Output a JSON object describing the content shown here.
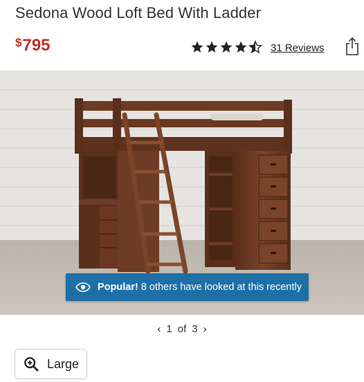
{
  "product": {
    "title": "Sedona Wood Loft Bed With Ladder",
    "price_currency": "$",
    "price_amount": "795",
    "rating": 4.5,
    "reviews_label": "31 Reviews"
  },
  "banner": {
    "bold": "Popular!",
    "text": "8 others have looked at this recently",
    "color": "#1d6fa6"
  },
  "gallery": {
    "current": "1",
    "separator": "of",
    "total": "3"
  },
  "zoom": {
    "label": "Large"
  },
  "icons": {
    "share": "share-icon",
    "eye": "eye-icon",
    "zoom": "zoom-in-icon"
  },
  "colors": {
    "price": "#c0312b",
    "wood": "#6b3a22"
  }
}
